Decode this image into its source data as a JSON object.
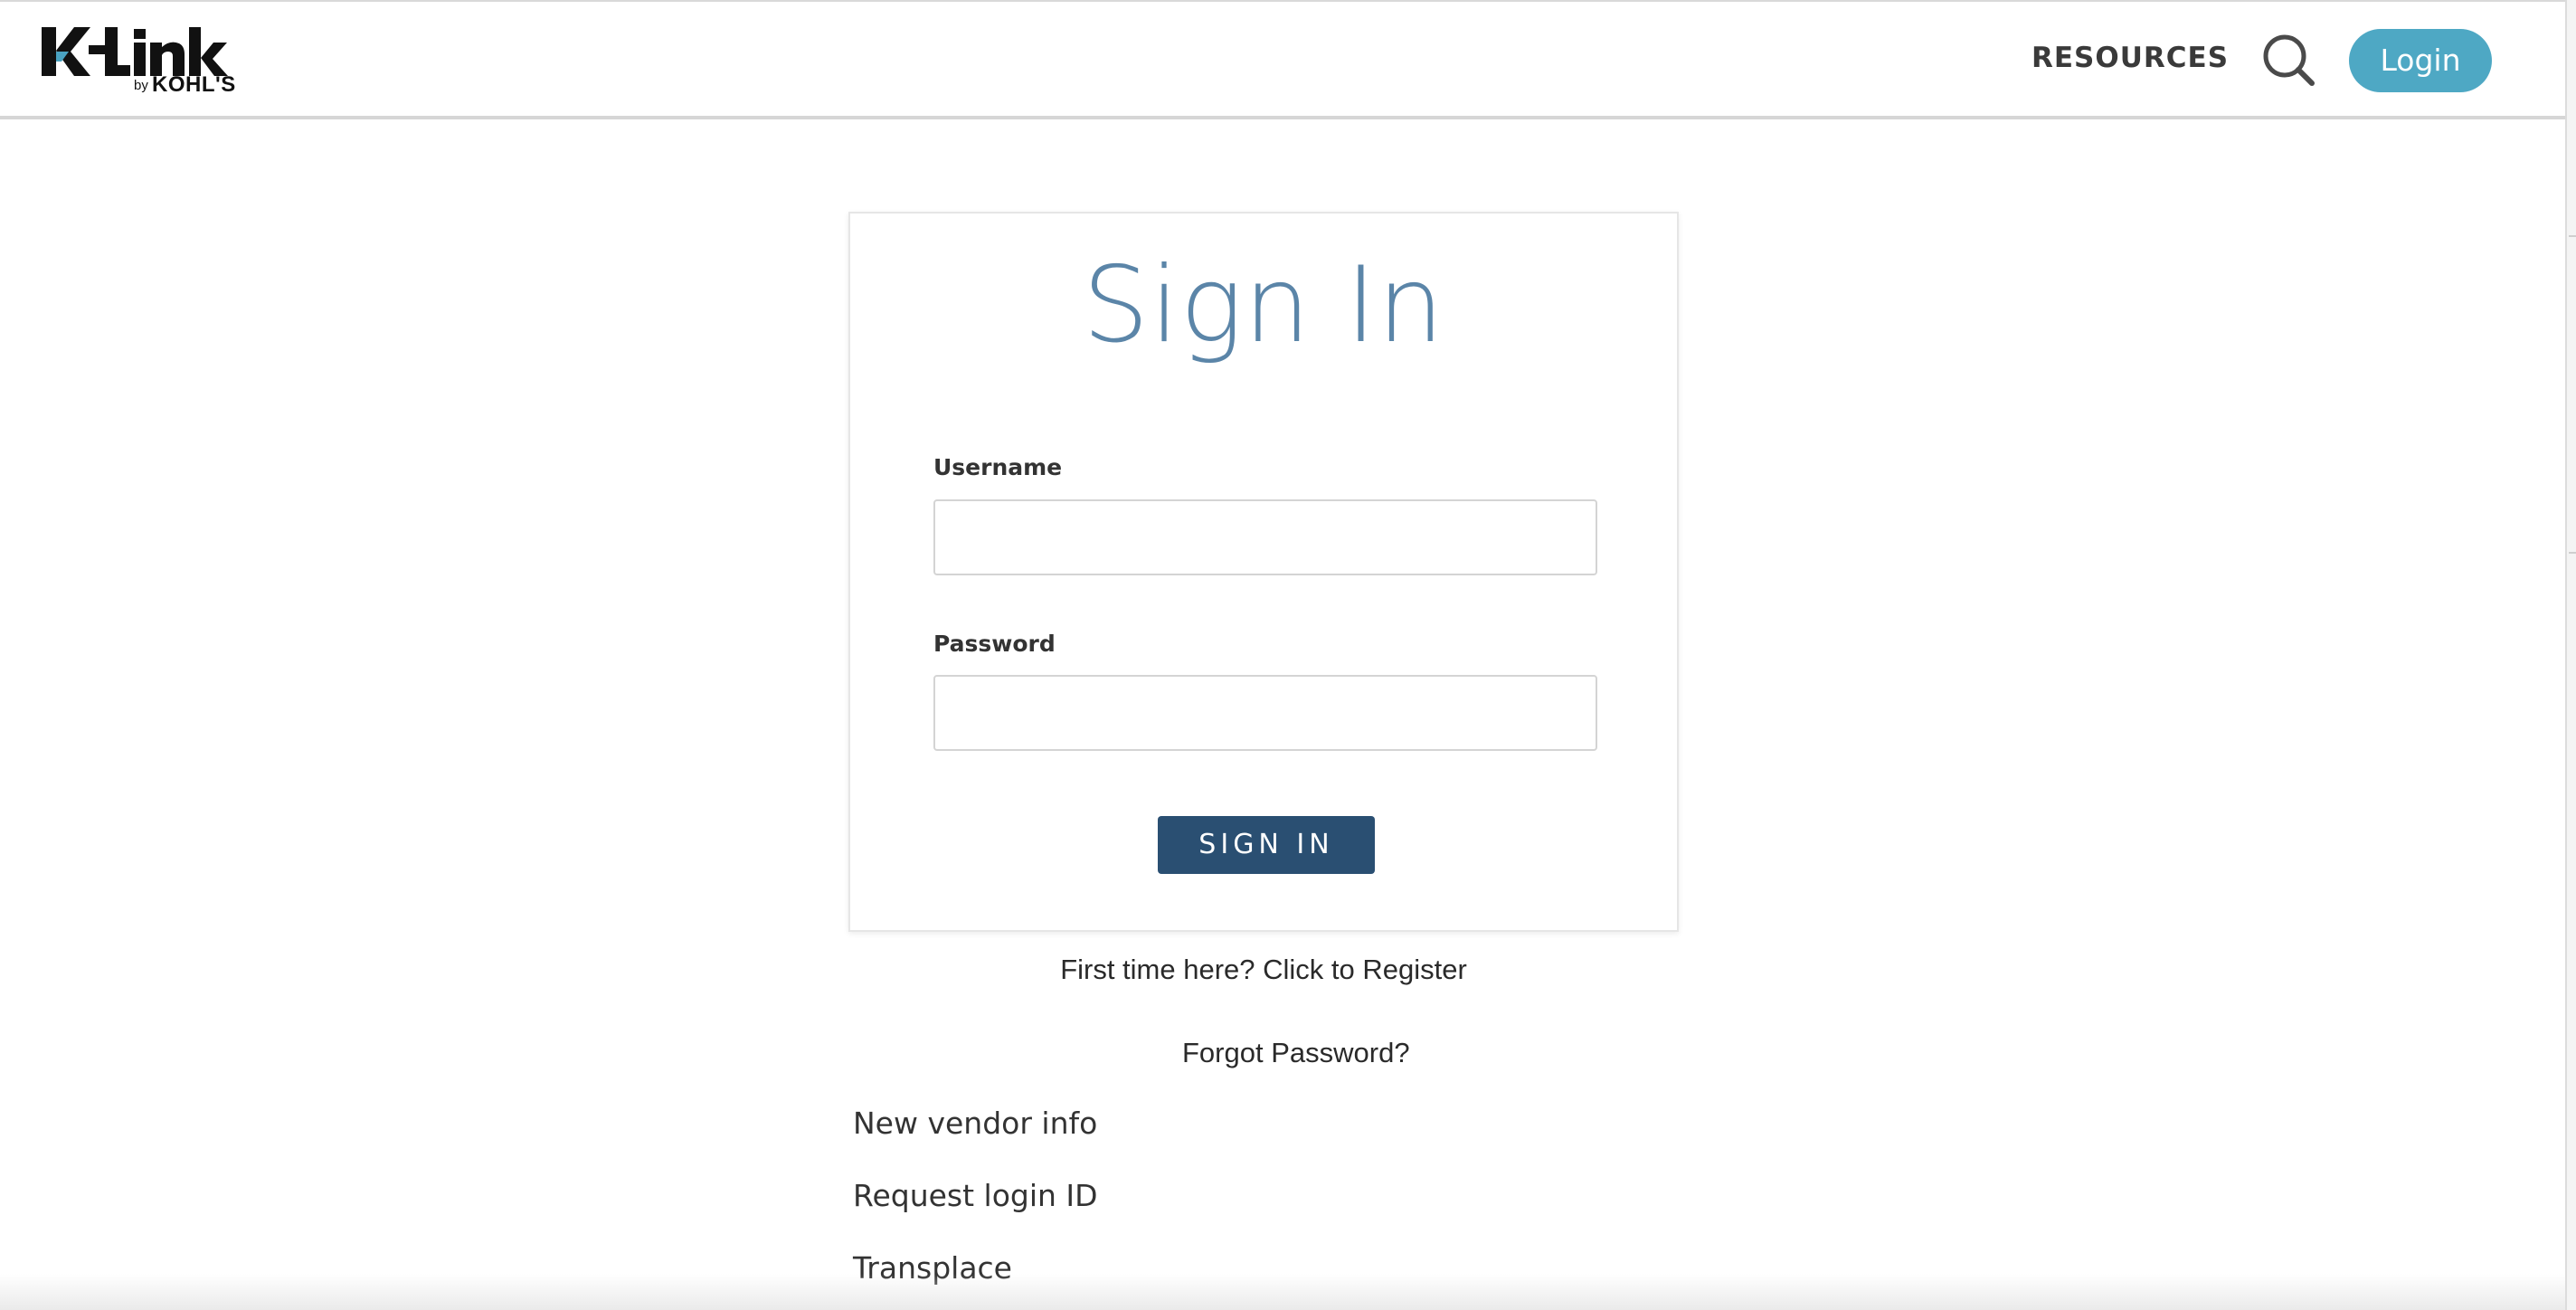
{
  "header": {
    "logo": {
      "main": "K-Link",
      "by": "by",
      "brand": "KOHL'S"
    },
    "nav": {
      "resources_label": "RESOURCES",
      "search_icon": "search-icon",
      "login_label": "Login"
    }
  },
  "signin_card": {
    "title": "Sign In",
    "username_label": "Username",
    "username_value": "",
    "password_label": "Password",
    "password_value": "",
    "submit_label": "SIGN IN"
  },
  "links": {
    "register": "First time here? Click to Register",
    "forgot_password": "Forgot Password?",
    "new_vendor_info": "New vendor info",
    "request_login_id": "Request login ID",
    "transplace": "Transplace"
  },
  "colors": {
    "login_button": "#4ea8c4",
    "title_text": "#5b85a8",
    "signin_button": "#2a4f72",
    "logo_accent": "#4aa3c2"
  }
}
